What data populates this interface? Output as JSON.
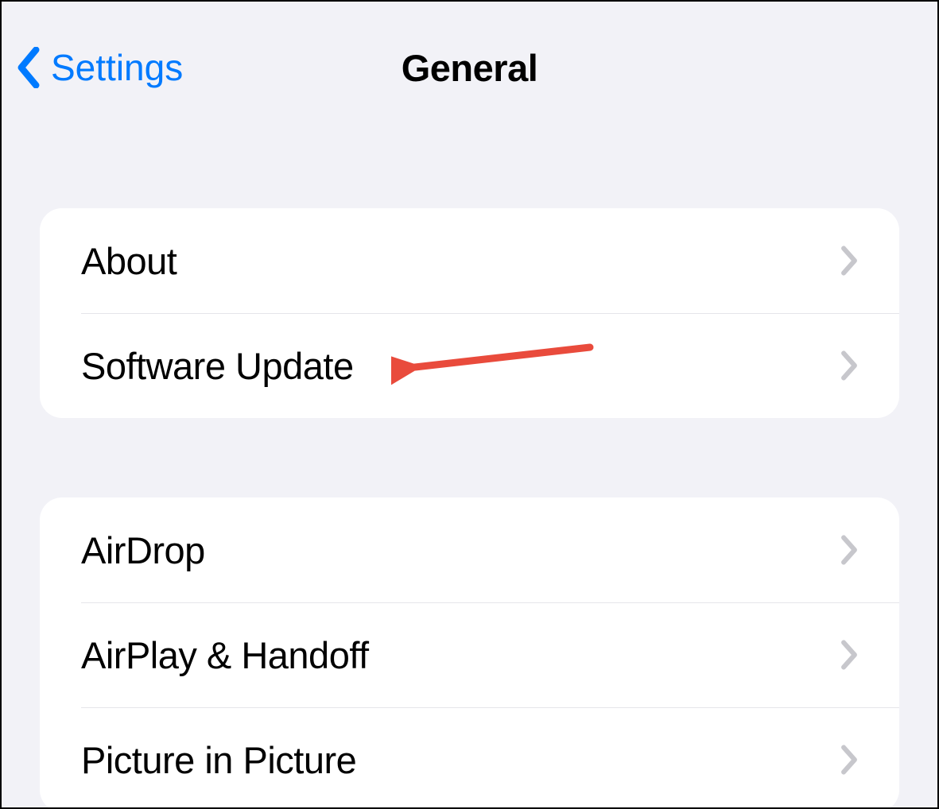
{
  "nav": {
    "back_label": "Settings",
    "title": "General"
  },
  "groups": [
    {
      "items": [
        {
          "label": "About"
        },
        {
          "label": "Software Update"
        }
      ]
    },
    {
      "items": [
        {
          "label": "AirDrop"
        },
        {
          "label": "AirPlay & Handoff"
        },
        {
          "label": "Picture in Picture"
        }
      ]
    }
  ],
  "colors": {
    "accent": "#007aff",
    "background": "#f2f2f7",
    "group_bg": "#ffffff",
    "separator": "#e5e5ea",
    "chevron": "#c7c7cc",
    "annotation": "#e94b3c"
  }
}
